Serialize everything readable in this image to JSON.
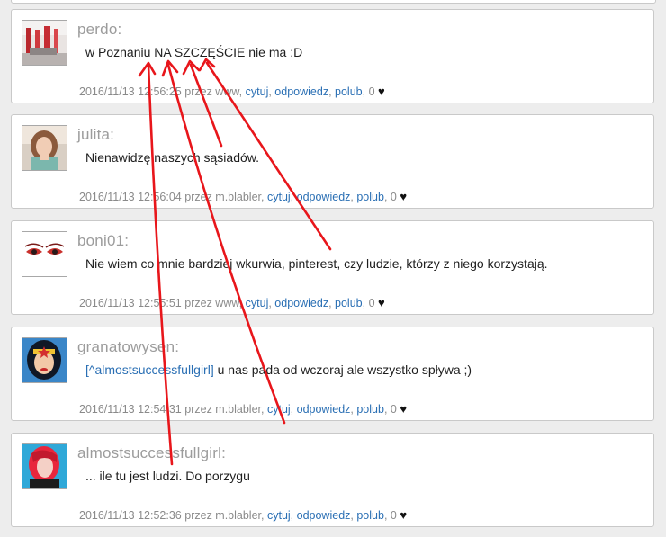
{
  "posts": [
    {
      "nick": "perdo:",
      "text": "w Poznaniu NA SZCZĘŚCIE nie ma :D",
      "mention": "",
      "timestamp": "2016/11/13 12:56:25",
      "by": "przez www,",
      "actions": {
        "quote": "cytuj",
        "reply": "odpowiedz",
        "like": "polub"
      },
      "like_count": "0",
      "avatar_icon": "photo-icon"
    },
    {
      "nick": "julita:",
      "text": "Nienawidzę naszych sąsiadów.",
      "mention": "",
      "timestamp": "2016/11/13 12:56:04",
      "by": "przez m.blabler,",
      "actions": {
        "quote": "cytuj",
        "reply": "odpowiedz",
        "like": "polub"
      },
      "like_count": "0",
      "avatar_icon": "portrait-icon"
    },
    {
      "nick": "boni01:",
      "text": "Nie wiem co mnie bardziej wkurwia, pinterest, czy ludzie, którzy z niego korzystają.",
      "mention": "",
      "timestamp": "2016/11/13 12:55:51",
      "by": "przez www,",
      "actions": {
        "quote": "cytuj",
        "reply": "odpowiedz",
        "like": "polub"
      },
      "like_count": "0",
      "avatar_icon": "eyes-icon"
    },
    {
      "nick": "granatowysen:",
      "text": " u nas pada od wczoraj ale wszystko spływa ;)",
      "mention": "[^almostsuccessfullgirl]",
      "timestamp": "2016/11/13 12:54:31",
      "by": "przez m.blabler,",
      "actions": {
        "quote": "cytuj",
        "reply": "odpowiedz",
        "like": "polub"
      },
      "like_count": "0",
      "avatar_icon": "wonder-woman-icon"
    },
    {
      "nick": "almostsuccessfullgirl:",
      "text": "... ile tu jest ludzi. Do porzygu",
      "mention": "",
      "timestamp": "2016/11/13 12:52:36",
      "by": "przez m.blabler,",
      "actions": {
        "quote": "cytuj",
        "reply": "odpowiedz",
        "like": "polub"
      },
      "like_count": "0",
      "avatar_icon": "red-hair-portrait-icon"
    }
  ],
  "colors": {
    "link": "#2a6fb4",
    "nick": "#9c9c9c",
    "meta": "#8a8a8a",
    "annotation_arrow": "#e8161b"
  }
}
